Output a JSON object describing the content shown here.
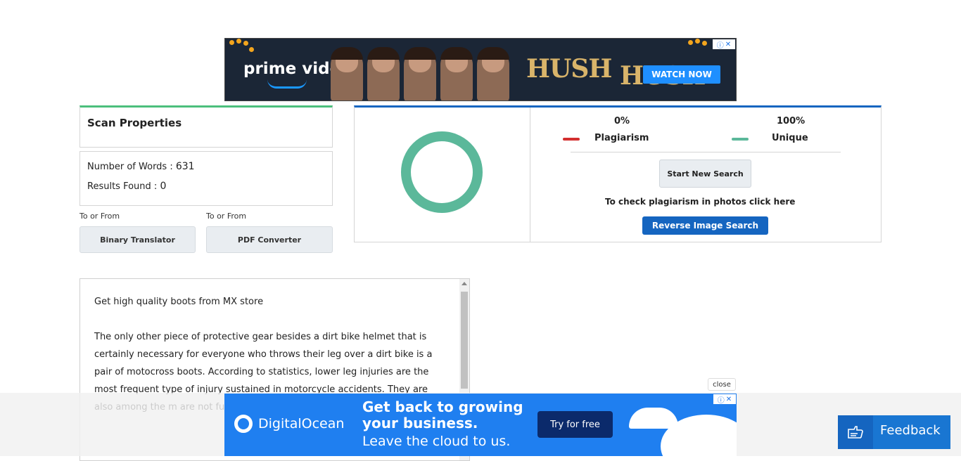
{
  "top_ad": {
    "brand": "prime video",
    "title_part1": "HUSH",
    "title_part2": "HUSH",
    "cta": "WATCH NOW"
  },
  "scan_properties": {
    "title": "Scan Properties",
    "words_label": "Number of Words :",
    "words_value": "631",
    "results_label": "Results Found :",
    "results_value": "0"
  },
  "tools": [
    {
      "caption": "To or From",
      "label": "Binary Translator"
    },
    {
      "caption": "To or From",
      "label": "PDF Converter"
    }
  ],
  "result": {
    "plagiarism_percent": "0%",
    "plagiarism_label": "Plagiarism",
    "unique_percent": "100%",
    "unique_label": "Unique",
    "start_button": "Start New Search",
    "photo_hint": "To check plagiarism in photos click here",
    "reverse_button": "Reverse Image Search",
    "colors": {
      "plagiarism": "#d32f2f",
      "unique": "#5bb89a"
    },
    "unique_fraction": 1.0
  },
  "text_content": {
    "heading": "Get high quality boots from MX store",
    "paragraph": "The only other piece of protective gear besides a dirt bike helmet that is certainly necessary for everyone who throws their leg over a dirt bike is a pair of motocross boots. According to statistics, lower leg injuries are the most frequent type of injury sustained in motorcycle accidents. They are also among the m                  are not fun). The likelihood                  with the help of a good pa"
  },
  "bottom_ad": {
    "close_label": "close",
    "brand": "DigitalOcean",
    "headline": "Get back to growing your business.",
    "subline": "Leave the cloud to us.",
    "cta": "Try for free"
  },
  "feedback": {
    "label": "Feedback"
  }
}
